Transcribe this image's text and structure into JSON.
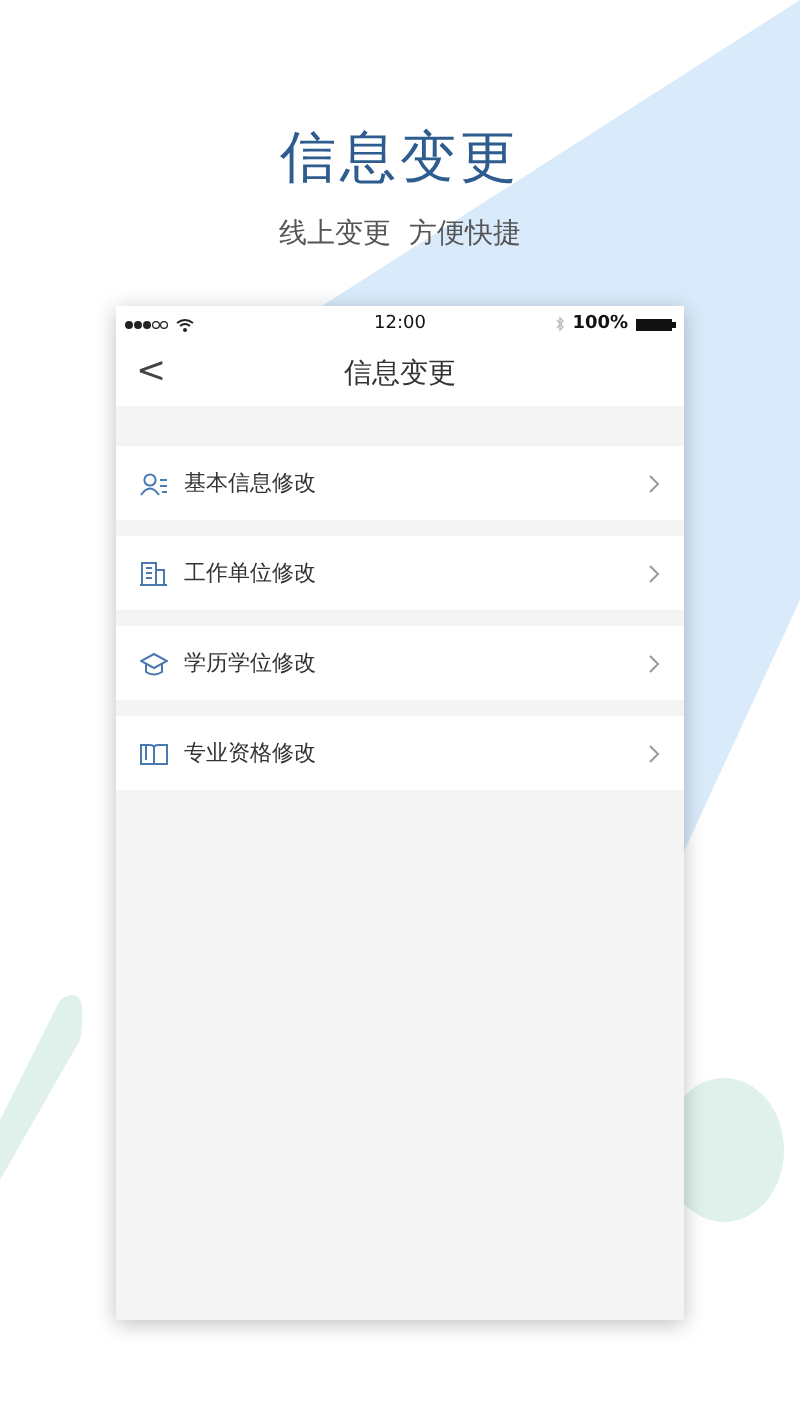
{
  "header": {
    "title": "信息变更",
    "subtitle": "线上变更  方便快捷"
  },
  "status_bar": {
    "time": "12:00",
    "battery": "100%"
  },
  "nav": {
    "back": "<",
    "title": "信息变更"
  },
  "items": [
    {
      "kind": "person",
      "label": "基本信息修改"
    },
    {
      "kind": "building",
      "label": "工作单位修改"
    },
    {
      "kind": "cap",
      "label": "学历学位修改"
    },
    {
      "kind": "book",
      "label": "专业资格修改"
    }
  ]
}
